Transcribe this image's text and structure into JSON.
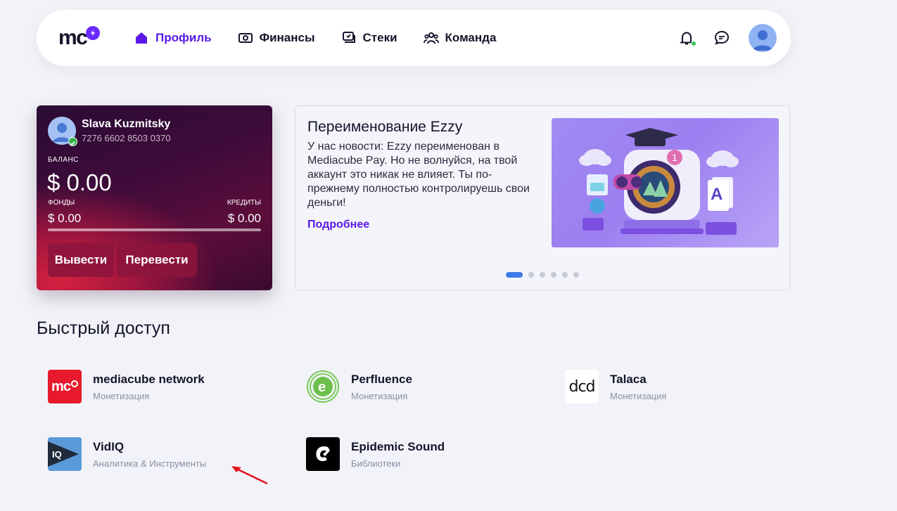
{
  "header": {
    "logo_text": "mc",
    "nav": [
      {
        "label": "Профиль",
        "icon": "home-icon",
        "active": true
      },
      {
        "label": "Финансы",
        "icon": "money-icon",
        "active": false
      },
      {
        "label": "Стеки",
        "icon": "stack-icon",
        "active": false
      },
      {
        "label": "Команда",
        "icon": "team-icon",
        "active": false
      }
    ],
    "accent_color": "#5a19e6"
  },
  "wallet": {
    "name": "Slava Kuzmitsky",
    "card_number": "7276 6602 8503 0370",
    "balance_label": "БАЛАНС",
    "balance": "$ 0.00",
    "funds_label": "ФОНДЫ",
    "funds": "$ 0.00",
    "credits_label": "КРЕДИТЫ",
    "credits": "$ 0.00",
    "withdraw_label": "Вывести",
    "transfer_label": "Перевести"
  },
  "news": {
    "title": "Переименование Ezzy",
    "text": "У нас новости: Ezzy переименован в Mediacube Pay. Но не волнуйся, на твой аккаунт это никак не влияет. Ты по-прежнему полностью контролируешь свои деньги!",
    "link": "Подробнее",
    "slides_total": 6,
    "active_slide": 1
  },
  "quick_access": {
    "title": "Быстрый доступ",
    "items": [
      {
        "name": "mediacube network",
        "category": "Монетизация",
        "logo_text": "mc",
        "logo_color": "#e8192c"
      },
      {
        "name": "Perfluence",
        "category": "Монетизация",
        "logo_text": "e",
        "logo_color": "#6cc04a"
      },
      {
        "name": "Talaca",
        "category": "Монетизация",
        "logo_text": "dcd",
        "logo_color": "#ffffff"
      },
      {
        "name": "VidIQ",
        "category": "Аналитика & Инструменты",
        "logo_text": "IQ",
        "logo_color": "#4d8fd6"
      },
      {
        "name": "Epidemic Sound",
        "category": "Библиотеки",
        "logo_text": "e",
        "logo_color": "#000000"
      }
    ]
  }
}
